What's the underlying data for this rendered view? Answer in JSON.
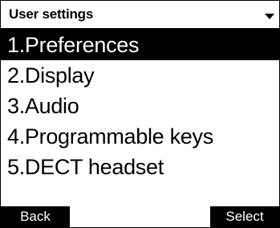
{
  "header": {
    "title": "User settings",
    "dropdown_icon": "triangle-down-icon"
  },
  "menu": {
    "selected_index": 0,
    "items": [
      {
        "label": "1.Preferences"
      },
      {
        "label": "2.Display"
      },
      {
        "label": "3.Audio"
      },
      {
        "label": "4.Programmable keys"
      },
      {
        "label": "5.DECT headset"
      }
    ]
  },
  "softkeys": {
    "left": "Back",
    "right": "Select"
  },
  "colors": {
    "background": "#ffffff",
    "foreground": "#000000",
    "highlight": "#000000",
    "highlight_text": "#ffffff"
  }
}
